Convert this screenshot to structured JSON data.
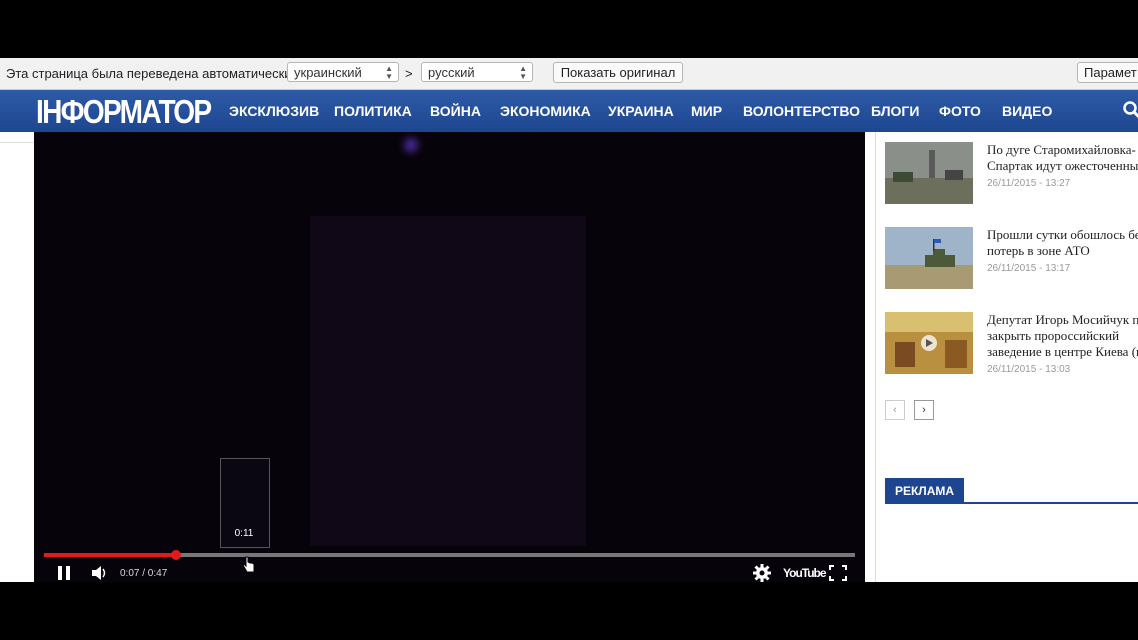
{
  "translate_bar": {
    "message": "Эта страница была переведена автоматически",
    "from_lang": "украинский",
    "arrow": ">",
    "to_lang": "русский",
    "show_original": "Показать оригинал",
    "options": "Парамет"
  },
  "site": {
    "logo": "ІНФОРМАТОР",
    "nav": [
      "ЭКСКЛЮЗИВ",
      "ПОЛИТИКА",
      "ВОЙНА",
      "ЭКОНОМИКА",
      "УКРАИНА",
      "МИР",
      "ВОЛОНТЕРСТВО",
      "БЛОГИ",
      "ФОТО",
      "ВИДЕО"
    ]
  },
  "player": {
    "preview_time": "0:11",
    "time_display": "0:07 / 0:47",
    "played_fraction": 0.163,
    "youtube_label": "YouTube"
  },
  "sidebar": {
    "news": [
      {
        "title_line1": "По дуге Старомихайловка-",
        "title_line2": "Спартак идут ожесточенные",
        "title_line3": "",
        "date": "26/11/2015 - 13:27"
      },
      {
        "title_line1": "Прошли сутки обошлось без",
        "title_line2": "потерь в зоне АТО",
        "title_line3": "",
        "date": "26/11/2015 - 13:17"
      },
      {
        "title_line1": "Депутат Игорь Мосийчук пр",
        "title_line2": "закрыть пророссийский",
        "title_line3": "заведение в центре Киева (в",
        "date": "26/11/2015 - 13:03"
      }
    ],
    "prev": "‹",
    "next": "›",
    "ad_label": "РЕКЛАМА"
  },
  "colors": {
    "nav": "#1e4690",
    "progress": "#e01b1b"
  }
}
